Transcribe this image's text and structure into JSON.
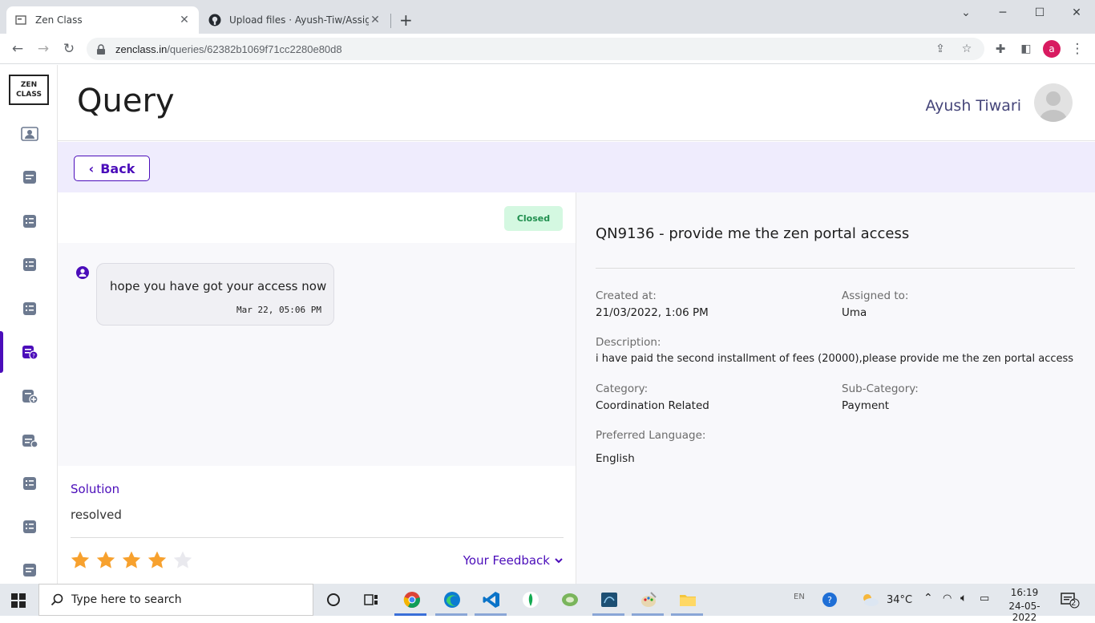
{
  "browser": {
    "tabs": [
      {
        "title": "Zen Class",
        "active": true
      },
      {
        "title": "Upload files · Ayush-Tiw/Assignm",
        "active": false
      }
    ],
    "url_host": "zenclass.in",
    "url_path": "/queries/62382b1069f71cc2280e80d8",
    "profile_initial": "a"
  },
  "sidebar": {
    "logo_line1": "ZEN",
    "logo_line2": "CLASS",
    "active_index": 5
  },
  "header": {
    "title": "Query",
    "user_name": "Ayush Tiwari"
  },
  "back_button": "Back",
  "status": "Closed",
  "chat": {
    "message": "hope you have got your access now",
    "time": "Mar 22, 05:06 PM"
  },
  "solution": {
    "label": "Solution",
    "text": "resolved",
    "rating": 4,
    "rating_max": 5,
    "feedback_label": "Your Feedback"
  },
  "details": {
    "title": "QN9136 - provide me the zen portal access",
    "created_label": "Created at:",
    "created_value": "21/03/2022, 1:06 PM",
    "assigned_label": "Assigned to:",
    "assigned_value": "Uma",
    "description_label": "Description:",
    "description_value": "i have paid the second installment of fees (20000),please provide me the zen portal access",
    "category_label": "Category:",
    "category_value": "Coordination Related",
    "subcategory_label": "Sub-Category:",
    "subcategory_value": "Payment",
    "language_label": "Preferred Language:",
    "language_value": "English"
  },
  "colors": {
    "accent": "#4b0dba",
    "star": "#f7a12e",
    "badge_bg": "#d4f8e1",
    "badge_text": "#1f8f4e"
  },
  "taskbar": {
    "search_placeholder": "Type here to search",
    "lang": "EN",
    "temperature": "34°C",
    "time": "16:19",
    "date": "24-05-2022",
    "notification_count": "2"
  }
}
